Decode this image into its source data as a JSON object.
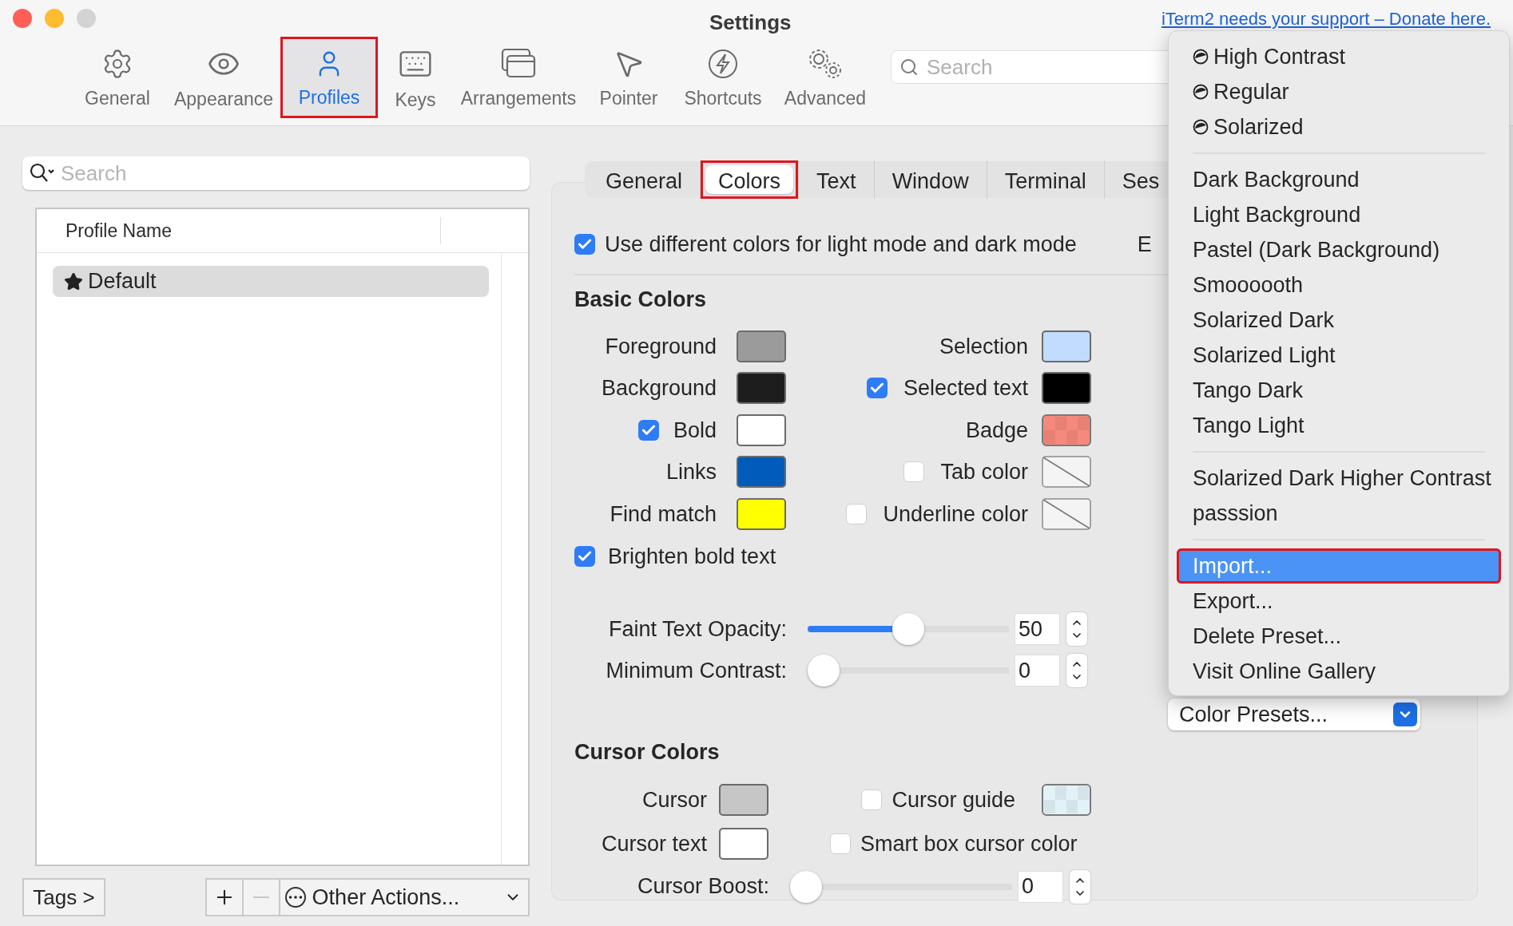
{
  "window": {
    "title": "Settings",
    "donate_link": "iTerm2 needs your support – Donate here."
  },
  "toolbar": {
    "items": [
      {
        "label": "General",
        "selected": false,
        "annotated": false
      },
      {
        "label": "Appearance",
        "selected": false,
        "annotated": false
      },
      {
        "label": "Profiles",
        "selected": true,
        "annotated": true
      },
      {
        "label": "Keys",
        "selected": false,
        "annotated": false
      },
      {
        "label": "Arrangements",
        "selected": false,
        "annotated": false
      },
      {
        "label": "Pointer",
        "selected": false,
        "annotated": false
      },
      {
        "label": "Shortcuts",
        "selected": false,
        "annotated": false
      },
      {
        "label": "Advanced",
        "selected": false,
        "annotated": false
      }
    ],
    "search": {
      "placeholder": "Search"
    }
  },
  "profiles": {
    "search": {
      "placeholder": "Search"
    },
    "columns": [
      "Profile Name"
    ],
    "rows": [
      {
        "name": "Default",
        "starred": true,
        "selected": true
      }
    ],
    "tags_button": "Tags >",
    "remove_button": {
      "disabled": true
    },
    "other_actions": "Other Actions..."
  },
  "profile_tabs": [
    {
      "label": "General",
      "selected": false,
      "annotated": false
    },
    {
      "label": "Colors",
      "selected": true,
      "annotated": true
    },
    {
      "label": "Text",
      "selected": false,
      "annotated": false
    },
    {
      "label": "Window",
      "selected": false,
      "annotated": false
    },
    {
      "label": "Terminal",
      "selected": false,
      "annotated": false
    },
    {
      "label": "Ses",
      "selected": false,
      "annotated": false
    }
  ],
  "mode_checkbox": {
    "label": "Use different colors for light mode and dark mode",
    "checked": true
  },
  "cut_label": "E",
  "basic_colors": {
    "title": "Basic Colors",
    "left": [
      {
        "label": "Foreground",
        "kind": "plain",
        "swatch": {
          "kind": "solid",
          "color": "#9b9b9b"
        }
      },
      {
        "label": "Background",
        "kind": "plain",
        "swatch": {
          "kind": "solid",
          "color": "#1d1d1d"
        }
      },
      {
        "label": "Bold",
        "kind": "checkbox",
        "checked": true,
        "swatch": {
          "kind": "solid",
          "color": "#ffffff"
        }
      },
      {
        "label": "Links",
        "kind": "plain",
        "swatch": {
          "kind": "solid",
          "color": "#005bbb"
        }
      },
      {
        "label": "Find match",
        "kind": "plain",
        "swatch": {
          "kind": "solid",
          "color": "#ffff00"
        }
      }
    ],
    "right": [
      {
        "label": "Selection",
        "kind": "plain",
        "swatch": {
          "kind": "solid",
          "color": "#c1dcfe"
        }
      },
      {
        "label": "Selected text",
        "kind": "checkbox",
        "checked": true,
        "swatch": {
          "kind": "solid",
          "color": "#000000"
        }
      },
      {
        "label": "Badge",
        "kind": "plain",
        "swatch": {
          "kind": "checker",
          "color": "#f58a7c"
        }
      },
      {
        "label": "Tab color",
        "kind": "checkbox",
        "checked": false,
        "swatch": {
          "kind": "none"
        }
      },
      {
        "label": "Underline color",
        "kind": "checkbox",
        "checked": false,
        "swatch": {
          "kind": "none"
        }
      }
    ]
  },
  "brighten_bold": {
    "label": "Brighten bold text",
    "checked": true
  },
  "sliders": [
    {
      "label": "Faint Text Opacity:",
      "level": 0.5,
      "value": "50"
    },
    {
      "label": "Minimum Contrast:",
      "level": 0,
      "value": "0"
    }
  ],
  "cursor_colors": {
    "title": "Cursor Colors",
    "left": [
      {
        "label": "Cursor",
        "swatch": {
          "kind": "solid",
          "color": "#c6c6c6"
        }
      },
      {
        "label": "Cursor text",
        "swatch": {
          "kind": "solid",
          "color": "#ffffff"
        }
      }
    ],
    "right": [
      {
        "label": "Cursor guide",
        "checked": false,
        "swatch": {
          "kind": "checker",
          "color": "#e2f3f8"
        }
      },
      {
        "label": "Smart box cursor color",
        "checked": false
      }
    ],
    "boost": {
      "label": "Cursor Boost:",
      "level": 0,
      "value": "0"
    }
  },
  "presets_menu": {
    "sections": [
      [
        {
          "label": "High Contrast",
          "kind": "mode",
          "selected": false,
          "annotated": false
        },
        {
          "label": "Regular",
          "kind": "mode",
          "selected": false,
          "annotated": false
        },
        {
          "label": "Solarized",
          "kind": "mode",
          "selected": false,
          "annotated": false
        }
      ],
      [
        {
          "label": "Dark Background",
          "kind": "plain",
          "selected": false,
          "annotated": false
        },
        {
          "label": "Light Background",
          "kind": "plain",
          "selected": false,
          "annotated": false
        },
        {
          "label": "Pastel (Dark Background)",
          "kind": "plain",
          "selected": false,
          "annotated": false
        },
        {
          "label": "Smoooooth",
          "kind": "plain",
          "selected": false,
          "annotated": false
        },
        {
          "label": "Solarized Dark",
          "kind": "plain",
          "selected": false,
          "annotated": false
        },
        {
          "label": "Solarized Light",
          "kind": "plain",
          "selected": false,
          "annotated": false
        },
        {
          "label": "Tango Dark",
          "kind": "plain",
          "selected": false,
          "annotated": false
        },
        {
          "label": "Tango Light",
          "kind": "plain",
          "selected": false,
          "annotated": false
        }
      ],
      [
        {
          "label": "Solarized Dark Higher Contrast",
          "kind": "plain",
          "selected": false,
          "annotated": false
        },
        {
          "label": "passsion",
          "kind": "plain",
          "selected": false,
          "annotated": false
        }
      ],
      [
        {
          "label": "Import...",
          "kind": "plain",
          "selected": true,
          "annotated": true
        },
        {
          "label": "Export...",
          "kind": "plain",
          "selected": false,
          "annotated": false
        },
        {
          "label": "Delete Preset...",
          "kind": "plain",
          "selected": false,
          "annotated": false
        },
        {
          "label": "Visit Online Gallery",
          "kind": "plain",
          "selected": false,
          "annotated": false
        }
      ]
    ],
    "popup": {
      "label": "Color Presets..."
    }
  }
}
